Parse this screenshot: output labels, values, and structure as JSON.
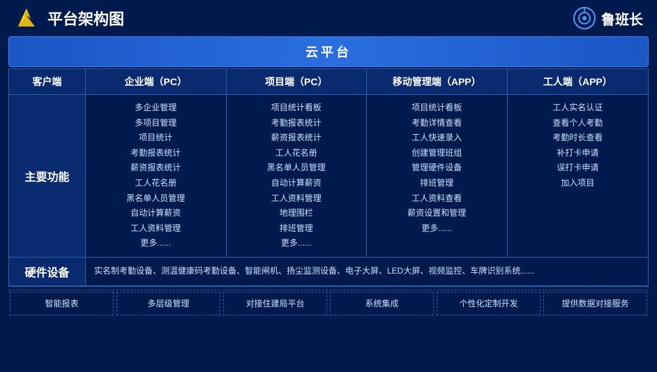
{
  "header": {
    "title": "平台架构图",
    "brand": "鲁班长"
  },
  "cloud": {
    "label": "云平台"
  },
  "columns": {
    "client": "客户端",
    "enterprise": "企业端（PC）",
    "project": "项目端（PC）",
    "mobile": "移动管理端（APP）",
    "worker": "工人端（APP）"
  },
  "main_function_label": "主要功能",
  "enterprise_features": [
    "多企业管理",
    "多项目管理",
    "项目统计",
    "考勤报表统计",
    "薪资报表统计",
    "工人花名册",
    "黑名单人员管理",
    "自动计算薪资",
    "工人资料管理",
    "更多......"
  ],
  "project_features": [
    "项目统计看板",
    "考勤报表统计",
    "薪资报表统计",
    "工人花名册",
    "黑名单人员管理",
    "自动计算薪资",
    "工人资料管理",
    "地理围栏",
    "排班管理",
    "更多......"
  ],
  "mobile_features": [
    "项目统计看板",
    "考勤详情查看",
    "工人快速录入",
    "创建管理班组",
    "管理硬件设备",
    "排班管理",
    "工人资料查看",
    "薪资设置和管理",
    "更多......"
  ],
  "worker_features": [
    "工人实名认证",
    "查看个人考勤",
    "考勤时长查看",
    "补打卡申请",
    "误打卡申请",
    "加入项目"
  ],
  "hardware": {
    "label": "硬件设备",
    "content": "实名制考勤设备、测温健康码考勤设备、智能闸机、扬尘监测设备、电子大屏、LED大屏、视频监控、车牌识别系统......"
  },
  "bottom_features": [
    "智能报表",
    "多层级管理",
    "对接住建局平台",
    "系统集成",
    "个性化定制开发",
    "提供数据对接服务"
  ]
}
